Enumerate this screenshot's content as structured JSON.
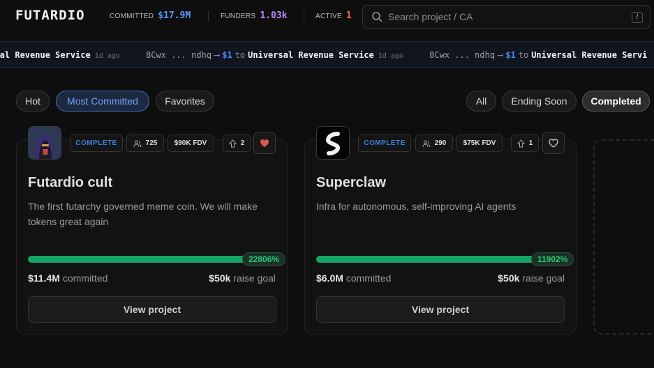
{
  "header": {
    "logo": "FUTARDIO",
    "stats": [
      {
        "label": "COMMITTED",
        "value": "$17.9M",
        "color": "#5b9bff"
      },
      {
        "label": "FUNDERS",
        "value": "1.03k",
        "color": "#b98cff"
      },
      {
        "label": "ACTIVE",
        "value": "1",
        "color": "#ff5a5a"
      }
    ],
    "search": {
      "placeholder": "Search project / CA",
      "shortcut": "/"
    }
  },
  "ticker": [
    {
      "addr": "",
      "amount": "",
      "to": "",
      "name": "ersal Revenue Service",
      "ago": "1d ago"
    },
    {
      "addr": "8Cwx ... ndhq",
      "amount": "$1",
      "to": "to",
      "name": "Universal Revenue Service",
      "ago": "1d ago"
    },
    {
      "addr": "8Cwx ... ndhq",
      "amount": "$1",
      "to": "to",
      "name": "Universal Revenue Servi",
      "ago": ""
    }
  ],
  "filters": {
    "left": [
      "Hot",
      "Most Committed",
      "Favorites"
    ],
    "right": [
      "All",
      "Ending Soon",
      "Completed"
    ]
  },
  "cards": [
    {
      "status": "COMPLETE",
      "funders": "725",
      "fdv": "$90K FDV",
      "votes": "2",
      "favorited": true,
      "title": "Futardio cult",
      "description": "The first futarchy governed meme coin. We will make tokens great again",
      "progress_fraction": 1.0,
      "percent": "22806%",
      "committed_amount": "$11.4M",
      "committed_label": "committed",
      "goal_amount": "$50k",
      "goal_label": "raise goal",
      "button": "View project"
    },
    {
      "status": "COMPLETE",
      "funders": "290",
      "fdv": "$75K FDV",
      "votes": "1",
      "favorited": false,
      "title": "Superclaw",
      "description": "Infra for autonomous, self-improving AI agents",
      "progress_fraction": 1.0,
      "percent": "11902%",
      "committed_amount": "$6.0M",
      "committed_label": "committed",
      "goal_amount": "$50k",
      "goal_label": "raise goal",
      "button": "View project"
    }
  ]
}
